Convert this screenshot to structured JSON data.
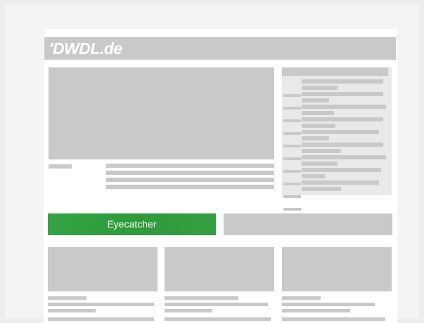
{
  "logo": {
    "text": "'DWDL.de"
  },
  "eyecatcher": {
    "label": "Eyecatcher"
  },
  "colors": {
    "placeholder_gray": "#c9c9c9",
    "sidebar_bg": "#ebe8e8",
    "eyecatcher_green": "#2e9a3a",
    "page_bg": "#ffffff",
    "outer_bg": "#ededed"
  }
}
